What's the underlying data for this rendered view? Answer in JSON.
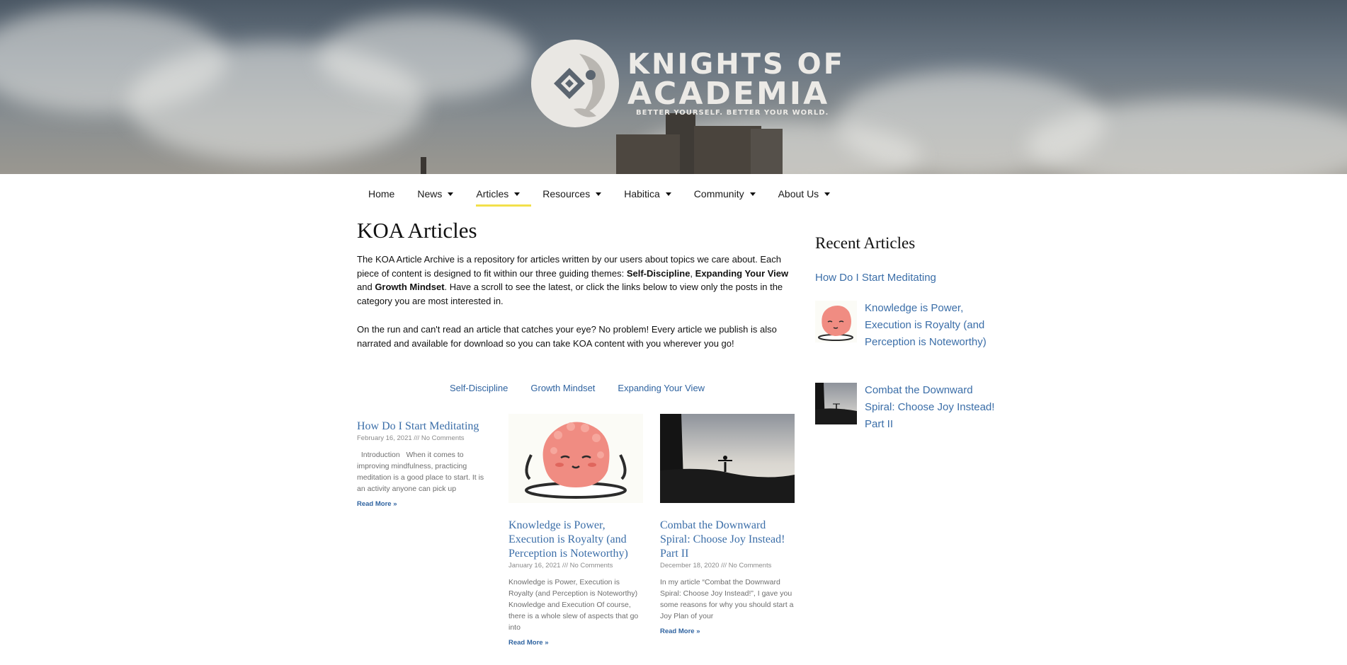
{
  "brand": {
    "name_line1": "KNIGHTS OF",
    "name_line2": "ACADEMIA",
    "tagline": "BETTER YOURSELF. BETTER YOUR WORLD."
  },
  "nav": {
    "items": [
      {
        "label": "Home",
        "has_dropdown": false,
        "active": false
      },
      {
        "label": "News",
        "has_dropdown": true,
        "active": false
      },
      {
        "label": "Articles",
        "has_dropdown": true,
        "active": true
      },
      {
        "label": "Resources",
        "has_dropdown": true,
        "active": false
      },
      {
        "label": "Habitica",
        "has_dropdown": true,
        "active": false
      },
      {
        "label": "Community",
        "has_dropdown": true,
        "active": false
      },
      {
        "label": "About Us",
        "has_dropdown": true,
        "active": false
      }
    ],
    "active_indicator_color": "#f2e04a"
  },
  "main": {
    "title": "KOA Articles",
    "intro": {
      "p1_a": "The KOA Article Archive is a repository for articles written by our users about topics we care about. Each piece of content is designed to fit within our three guiding themes: ",
      "theme1": "Self-Discipline",
      "sep1": ", ",
      "theme2": "Expanding Your View",
      "sep2": " and ",
      "theme3": "Growth Mindset",
      "p1_b": ". Have a scroll to see the latest, or click the links below to view only the posts in the category you are most interested in.",
      "p2": "On the run and can't read an article that catches your eye? No problem! Every article we publish is also narrated and available for download so you can take KOA content with you wherever you go!"
    },
    "categories": [
      "Self-Discipline",
      "Growth Mindset",
      "Expanding Your View"
    ],
    "posts": [
      {
        "title": "How Do I Start Meditating",
        "meta": "February 16, 2021 /// No Comments",
        "excerpt": "  Introduction   When it comes to improving mindfulness, practicing meditation is a good place to start. It is an activity anyone can pick up",
        "read_more": "Read More »",
        "thumbnail": null
      },
      {
        "title": "Knowledge is Power, Execution is Royalty (and Perception is Noteworthy)",
        "meta": "January 16, 2021 /// No Comments",
        "excerpt": "Knowledge is Power, Execution is Royalty (and Perception is Noteworthy) Knowledge and Execution Of course, there is a whole slew of aspects that go into",
        "read_more": "Read More »",
        "thumbnail": "meditating-brain-icon"
      },
      {
        "title": "Combat the Downward Spiral: Choose Joy Instead! Part II",
        "meta": "December 18, 2020 /// No Comments",
        "excerpt": "In my article “Combat the Downward Spiral: Choose Joy Instead!”, I gave you some reasons for why you should start a Joy Plan of your",
        "read_more": "Read More »",
        "thumbnail": "silhouette-sunset-image"
      }
    ]
  },
  "sidebar": {
    "title": "Recent Articles",
    "items": [
      {
        "label": "How Do I Start Meditating",
        "thumbnail": null
      },
      {
        "label": "Knowledge is Power, Execution is Royalty (and Perception is Noteworthy)",
        "thumbnail": "meditating-brain-icon"
      },
      {
        "label": "Combat the Downward Spiral: Choose Joy Instead! Part II",
        "thumbnail": "silhouette-sunset-image"
      }
    ]
  },
  "colors": {
    "link": "#3b6ea8",
    "category_link": "#2f63a0",
    "meta": "#8b8b8b",
    "excerpt": "#6f6f6f"
  }
}
